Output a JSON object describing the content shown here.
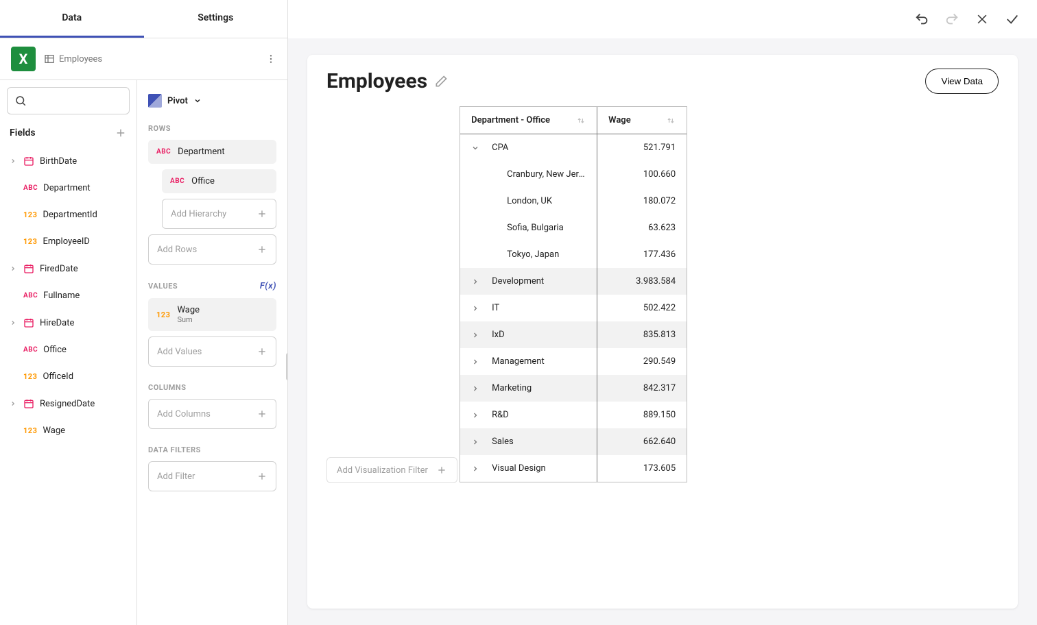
{
  "tabs": {
    "data": "Data",
    "settings": "Settings"
  },
  "datasource": {
    "name": "Employees"
  },
  "fields": {
    "header": "Fields",
    "items": [
      {
        "label": "BirthDate",
        "type": "date",
        "expandable": true
      },
      {
        "label": "Department",
        "type": "abc",
        "expandable": false
      },
      {
        "label": "DepartmentId",
        "type": "123",
        "expandable": false
      },
      {
        "label": "EmployeeID",
        "type": "123",
        "expandable": false
      },
      {
        "label": "FiredDate",
        "type": "date",
        "expandable": true
      },
      {
        "label": "Fullname",
        "type": "abc",
        "expandable": false
      },
      {
        "label": "HireDate",
        "type": "date",
        "expandable": true
      },
      {
        "label": "Office",
        "type": "abc",
        "expandable": false
      },
      {
        "label": "OfficeId",
        "type": "123",
        "expandable": false
      },
      {
        "label": "ResignedDate",
        "type": "date",
        "expandable": true
      },
      {
        "label": "Wage",
        "type": "123",
        "expandable": false
      }
    ]
  },
  "config": {
    "viz_type": "Pivot",
    "rows_label": "ROWS",
    "rows": [
      {
        "label": "Department",
        "type": "abc"
      },
      {
        "label": "Office",
        "type": "abc"
      }
    ],
    "add_hierarchy": "Add Hierarchy",
    "add_rows": "Add Rows",
    "values_label": "VALUES",
    "fx_label": "F(x)",
    "values": [
      {
        "label": "Wage",
        "sub": "Sum",
        "type": "123"
      }
    ],
    "add_values": "Add Values",
    "columns_label": "COLUMNS",
    "add_columns": "Add Columns",
    "filters_label": "DATA FILTERS",
    "add_filter": "Add Filter"
  },
  "main": {
    "title": "Employees",
    "view_data": "View Data",
    "add_filter": "Add Visualization Filter",
    "col1": "Department - Office",
    "col2": "Wage",
    "rows": [
      {
        "label": "CPA",
        "value": "521.791",
        "level": 0,
        "expanded": true,
        "alt": false
      },
      {
        "label": "Cranbury, New Jersey, U…",
        "value": "100.660",
        "level": 2,
        "alt": false
      },
      {
        "label": "London, UK",
        "value": "180.072",
        "level": 2,
        "alt": false
      },
      {
        "label": "Sofia, Bulgaria",
        "value": "63.623",
        "level": 2,
        "alt": false
      },
      {
        "label": "Tokyo, Japan",
        "value": "177.436",
        "level": 2,
        "alt": false
      },
      {
        "label": "Development",
        "value": "3.983.584",
        "level": 0,
        "expanded": false,
        "alt": true
      },
      {
        "label": "IT",
        "value": "502.422",
        "level": 0,
        "expanded": false,
        "alt": false
      },
      {
        "label": "IxD",
        "value": "835.813",
        "level": 0,
        "expanded": false,
        "alt": true
      },
      {
        "label": "Management",
        "value": "290.549",
        "level": 0,
        "expanded": false,
        "alt": false
      },
      {
        "label": "Marketing",
        "value": "842.317",
        "level": 0,
        "expanded": false,
        "alt": true
      },
      {
        "label": "R&D",
        "value": "889.150",
        "level": 0,
        "expanded": false,
        "alt": false
      },
      {
        "label": "Sales",
        "value": "662.640",
        "level": 0,
        "expanded": false,
        "alt": true
      },
      {
        "label": "Visual Design",
        "value": "173.605",
        "level": 0,
        "expanded": false,
        "alt": false
      }
    ]
  }
}
